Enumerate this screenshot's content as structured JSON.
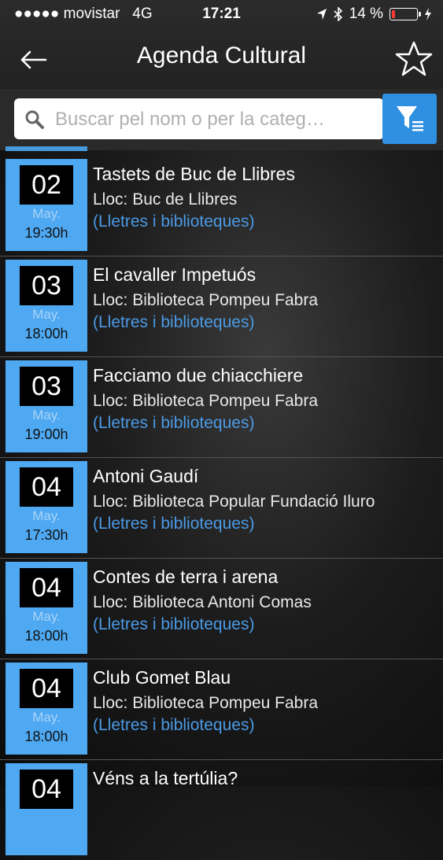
{
  "status_bar": {
    "carrier": "●●●●● movistar",
    "network": "4G",
    "time": "17:21",
    "battery": "14 %"
  },
  "header": {
    "title": "Agenda Cultural",
    "back_icon": "arrow-left-icon",
    "favorite_icon": "star-icon"
  },
  "search": {
    "placeholder": "Buscar pel nom o per la categ…",
    "filter_icon": "filter-icon"
  },
  "colors": {
    "accent": "#2f8fe0",
    "date_box": "#4ea8f2",
    "category_text": "#4b9ae6"
  },
  "events": [
    {
      "day": "02",
      "month": "May.",
      "time": "19:30h",
      "title": "Tastets de Buc de Llibres",
      "place": "Lloc: Buc de Llibres",
      "category": "(Lletres i biblioteques)"
    },
    {
      "day": "03",
      "month": "May.",
      "time": "18:00h",
      "title": "El cavaller Impetuós",
      "place": "Lloc: Biblioteca Pompeu Fabra",
      "category": "(Lletres i biblioteques)"
    },
    {
      "day": "03",
      "month": "May.",
      "time": "19:00h",
      "title": "Facciamo due chiacchiere",
      "place": "Lloc: Biblioteca Pompeu Fabra",
      "category": "(Lletres i biblioteques)"
    },
    {
      "day": "04",
      "month": "May.",
      "time": "17:30h",
      "title": "Antoni Gaudí",
      "place": "Lloc: Biblioteca Popular Fundació Iluro",
      "category": "(Lletres i biblioteques)"
    },
    {
      "day": "04",
      "month": "May.",
      "time": "18:00h",
      "title": "Contes de terra i arena",
      "place": "Lloc: Biblioteca Antoni Comas",
      "category": "(Lletres i biblioteques)"
    },
    {
      "day": "04",
      "month": "May.",
      "time": "18:00h",
      "title": "Club Gomet Blau",
      "place": "Lloc: Biblioteca Pompeu Fabra",
      "category": "(Lletres i biblioteques)"
    },
    {
      "day": "04",
      "month": "",
      "time": "",
      "title": "Véns a la tertúlia?",
      "place": "",
      "category": ""
    }
  ]
}
